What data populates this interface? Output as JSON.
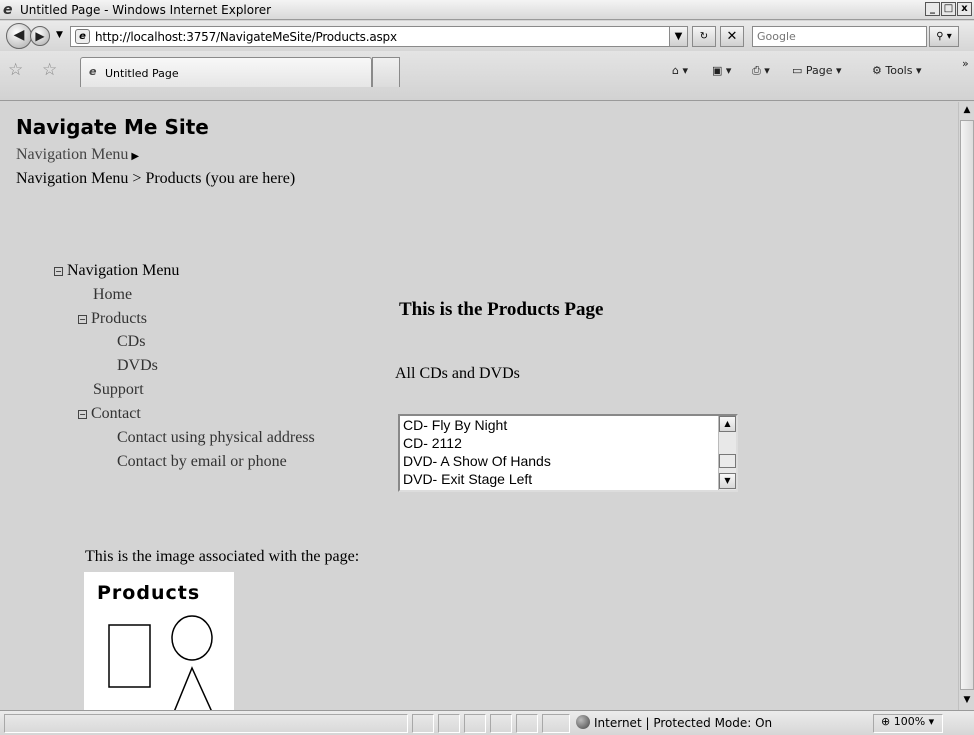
{
  "window": {
    "title": "Untitled Page - Windows Internet Explorer",
    "controls": [
      "_",
      "□",
      "x"
    ]
  },
  "navigation": {
    "url": "http://localhost:3757/NavigateMeSite/Products.aspx",
    "search_placeholder": "Google"
  },
  "tabs": [
    {
      "label": "Untitled Page"
    }
  ],
  "commandbar": {
    "page_label": "Page",
    "tools_label": "Tools"
  },
  "page": {
    "site_title": "Navigate Me Site",
    "menu_label": "Navigation Menu",
    "breadcrumb": "Navigation Menu > Products (you are here)",
    "tree": {
      "root": "Navigation Menu",
      "home": "Home",
      "products": "Products",
      "cds": "CDs",
      "dvds": "DVDs",
      "support": "Support",
      "contact": "Contact",
      "contact_physical": "Contact using physical address",
      "contact_email": "Contact by email or phone"
    },
    "heading": "This is the Products Page",
    "list_caption": "All CDs and DVDs",
    "list_items": [
      "CD- Fly By Night",
      "CD- 2112",
      "DVD- A Show Of Hands",
      "DVD- Exit Stage Left"
    ],
    "image_caption": "This is the image associated with the page:",
    "image_text": "Products"
  },
  "status": {
    "zone": "Internet | Protected Mode: On",
    "zoom": "100%"
  }
}
